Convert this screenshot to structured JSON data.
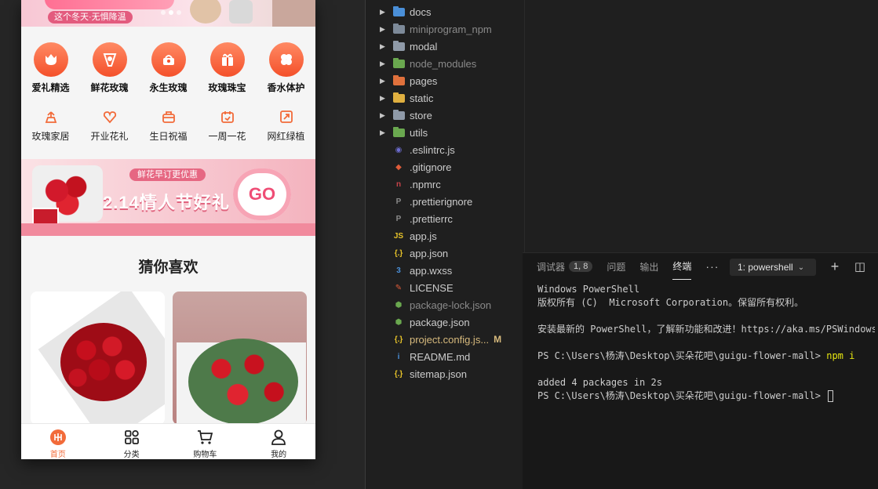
{
  "simulator": {
    "banner_slogan": "这个冬天·无惧降温",
    "categories_main": [
      {
        "label": "爱礼精选",
        "icon": "tulip-icon"
      },
      {
        "label": "鲜花玫瑰",
        "icon": "bouquet-icon"
      },
      {
        "label": "永生玫瑰",
        "icon": "cake-icon"
      },
      {
        "label": "玫瑰珠宝",
        "icon": "gift-icon"
      },
      {
        "label": "香水体护",
        "icon": "clover-icon"
      }
    ],
    "categories_sub": [
      {
        "label": "玫瑰家居",
        "icon": "house-plant-icon"
      },
      {
        "label": "开业花礼",
        "icon": "heart-flower-icon"
      },
      {
        "label": "生日祝福",
        "icon": "briefcase-icon"
      },
      {
        "label": "一周一花",
        "icon": "calendar-icon"
      },
      {
        "label": "网红绿植",
        "icon": "plant-pot-icon"
      }
    ],
    "promo": {
      "tag": "鲜花早订更优惠",
      "headline": "2.14情人节好礼",
      "cta": "GO"
    },
    "section_title": "猜你喜欢",
    "tabbar": [
      {
        "label": "首页",
        "icon": "home-flower-icon",
        "active": true
      },
      {
        "label": "分类",
        "icon": "category-grid-icon",
        "active": false
      },
      {
        "label": "购物车",
        "icon": "cart-icon",
        "active": false
      },
      {
        "label": "我的",
        "icon": "user-icon",
        "active": false
      }
    ],
    "accent_color": "#f26b3a"
  },
  "explorer": {
    "items": [
      {
        "name": "docs",
        "type": "folder",
        "icon_color": "#4a8fd8"
      },
      {
        "name": "miniprogram_npm",
        "type": "folder",
        "icon_color": "#7d8a99",
        "dim": true
      },
      {
        "name": "modal",
        "type": "folder",
        "icon_color": "#8f9aa8"
      },
      {
        "name": "node_modules",
        "type": "folder",
        "icon_color": "#6aa84f",
        "dim": true
      },
      {
        "name": "pages",
        "type": "folder",
        "icon_color": "#e0713c"
      },
      {
        "name": "static",
        "type": "folder",
        "icon_color": "#e0b040"
      },
      {
        "name": "store",
        "type": "folder",
        "icon_color": "#8f9aa8"
      },
      {
        "name": "utils",
        "type": "folder",
        "icon_color": "#6aa84f"
      },
      {
        "name": ".eslintrc.js",
        "type": "file",
        "glyph": "◉",
        "icon_color": "#6c6cd0"
      },
      {
        "name": ".gitignore",
        "type": "file",
        "glyph": "◆",
        "icon_color": "#e05c3a"
      },
      {
        "name": ".npmrc",
        "type": "file",
        "glyph": "n",
        "icon_color": "#c7434a"
      },
      {
        "name": ".prettierignore",
        "type": "file",
        "glyph": "P",
        "icon_color": "#8a8a8a"
      },
      {
        "name": ".prettierrc",
        "type": "file",
        "glyph": "P",
        "icon_color": "#8a8a8a"
      },
      {
        "name": "app.js",
        "type": "file",
        "glyph": "JS",
        "icon_color": "#e6c229"
      },
      {
        "name": "app.json",
        "type": "file",
        "glyph": "{.}",
        "icon_color": "#e6c229"
      },
      {
        "name": "app.wxss",
        "type": "file",
        "glyph": "3",
        "icon_color": "#4a8fd8"
      },
      {
        "name": "LICENSE",
        "type": "file",
        "glyph": "✎",
        "icon_color": "#e05c3a"
      },
      {
        "name": "package-lock.json",
        "type": "file",
        "glyph": "⬢",
        "icon_color": "#6aa84f",
        "dim": true
      },
      {
        "name": "package.json",
        "type": "file",
        "glyph": "⬢",
        "icon_color": "#6aa84f"
      },
      {
        "name": "project.config.js...",
        "type": "file",
        "glyph": "{.}",
        "icon_color": "#e6c229",
        "modified": true,
        "badge": "M"
      },
      {
        "name": "README.md",
        "type": "file",
        "glyph": "i",
        "icon_color": "#4a8fd8"
      },
      {
        "name": "sitemap.json",
        "type": "file",
        "glyph": "{.}",
        "icon_color": "#e6c229"
      }
    ]
  },
  "panel": {
    "tabs": [
      {
        "label": "调试器",
        "badge": "1, 8"
      },
      {
        "label": "问题"
      },
      {
        "label": "输出"
      },
      {
        "label": "终端",
        "active": true
      }
    ],
    "more": "···",
    "shell": "1: powershell",
    "add_button": "+",
    "split_button": "◫"
  },
  "terminal": {
    "lines": [
      "Windows PowerShell",
      "版权所有 (C)  Microsoft Corporation。保留所有权利。",
      "",
      "安装最新的 PowerShell，了解新功能和改进！https://aka.ms/PSWindows",
      "",
      "",
      "",
      "added 4 packages in 2s",
      "PS C:\\Users\\杨涛\\Desktop\\买朵花吧\\guigu-flower-mall> "
    ],
    "prompt": "PS C:\\Users\\杨涛\\Desktop\\买朵花吧\\guigu-flower-mall> ",
    "command": "npm i"
  }
}
